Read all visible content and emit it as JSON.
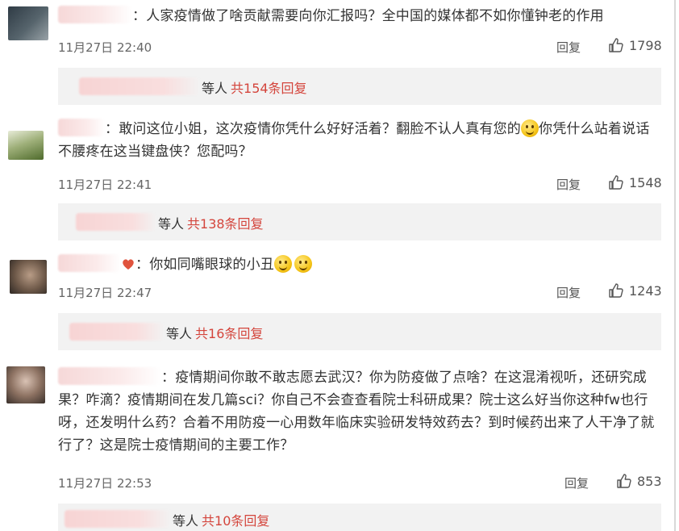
{
  "comments": [
    {
      "text": "：人家疫情做了啥贡献需要向你汇报吗？全中国的媒体都不如你懂钟老的作用",
      "time": "11月27日 22:40",
      "reply_label": "回复",
      "likes": "1798",
      "replies": {
        "suffix": "等人",
        "count": "共154条回复"
      }
    },
    {
      "text_line1_a": "：敢问这位小姐，这次疫情你凭什么好好活着？翻脸不认人真有您的",
      "text_line1_b": "你凭什么站着说话",
      "text_line2": "不腰疼在这当键盘侠？您配吗？",
      "time": "11月27日 22:41",
      "reply_label": "回复",
      "likes": "1548",
      "replies": {
        "suffix": "等人",
        "count": "共138条回复"
      }
    },
    {
      "text": "：你如同嘴眼球的小丑",
      "time": "11月27日 22:47",
      "reply_label": "回复",
      "likes": "1243",
      "replies": {
        "suffix": "等人",
        "count": "共16条回复"
      }
    },
    {
      "text_line1": "：疫情期间你敢不敢志愿去武汉？你为防疫做了点啥？在这混淆视听，还研究成",
      "text_line2": "果？咋滴？疫情期间在发几篇sci？你自己不会查查看院士科研成果？院士这么好当你这种fw也行",
      "text_line3": "呀，还发明什么药？合着不用防疫一心用数年临床实验研发特效药去？到时候药出来了人干净了就",
      "text_line4": "行了？这是院士疫情期间的主要工作？",
      "time": "11月27日 22:53",
      "reply_label": "回复",
      "likes": "853",
      "replies": {
        "suffix": "等人",
        "count": "共10条回复"
      }
    }
  ],
  "colors": {
    "reply_count": "#d4453c",
    "reply_bg": "#f2f2f2",
    "text": "#333333",
    "meta": "#666666"
  },
  "icons": {
    "like": "thumbs-up-icon",
    "emoji": "smiley-emoji-icon"
  }
}
